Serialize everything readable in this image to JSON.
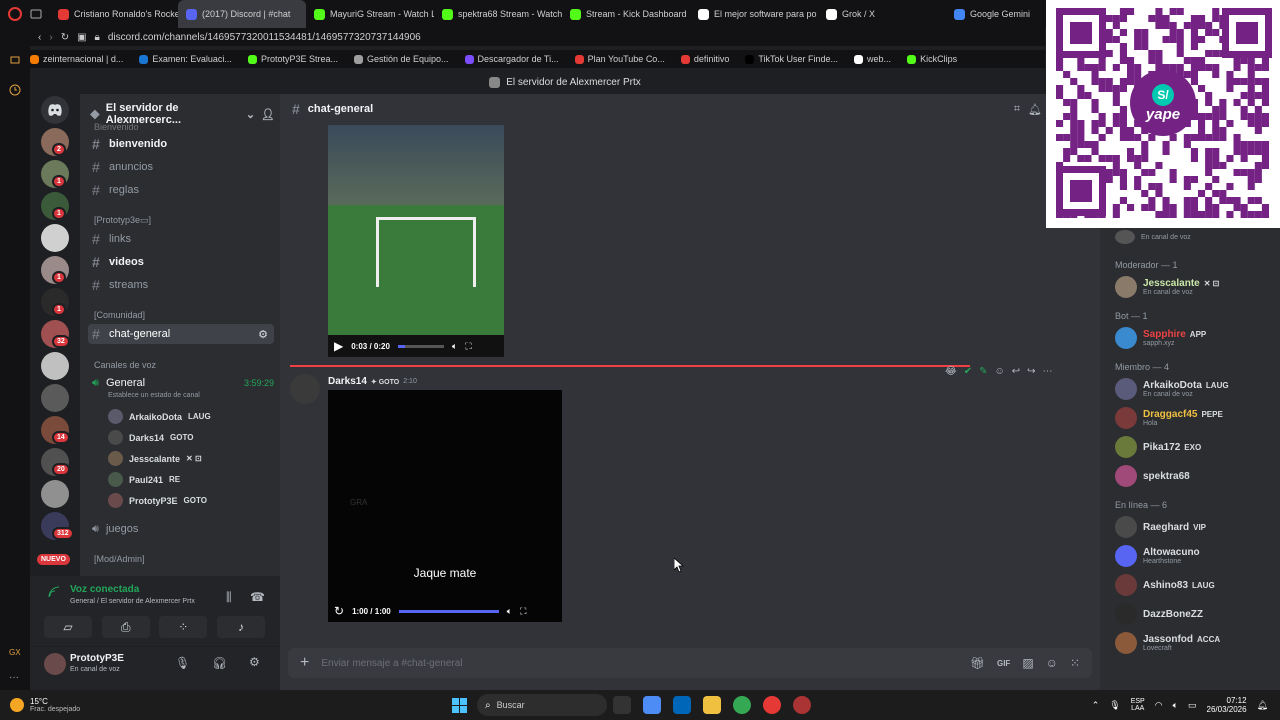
{
  "browser": {
    "tabs": [
      {
        "label": "Cristiano Ronaldo's Rocke",
        "color": "#e53935"
      },
      {
        "label": "(2017) Discord | #chat",
        "color": "#5865f2"
      },
      {
        "label": "MayuriG Stream - Watch L",
        "color": "#53fc18"
      },
      {
        "label": "spektra68 Stream - Watch",
        "color": "#53fc18"
      },
      {
        "label": "Stream - Kick Dashboard",
        "color": "#53fc18"
      },
      {
        "label": "El mejor software para po",
        "color": "#ffffff"
      },
      {
        "label": "Grok / X",
        "color": "#ffffff"
      },
      {
        "label": "Google Gemini",
        "color": "#4285f4"
      }
    ],
    "url": "discord.com/channels/1469577320011534481/1469577320737144906",
    "bookmarks": [
      {
        "label": "zeinternacional | d...",
        "color": "#f57c00"
      },
      {
        "label": "Examen: Evaluaci...",
        "color": "#1976d2"
      },
      {
        "label": "PrototyP3E Strea...",
        "color": "#53fc18"
      },
      {
        "label": "Gestión de Equipo...",
        "color": "#9e9e9e"
      },
      {
        "label": "Descargador de Ti...",
        "color": "#7c4dff"
      },
      {
        "label": "Plan YouTube Co...",
        "color": "#e53935"
      },
      {
        "label": "definitivo",
        "color": "#e53935"
      },
      {
        "label": "TikTok User Finde...",
        "color": "#000000"
      },
      {
        "label": "web...",
        "color": "#ffffff"
      },
      {
        "label": "KickClips",
        "color": "#53fc18"
      }
    ]
  },
  "app": {
    "window_title": "El servidor de Alexmercer Prtx",
    "server_name": "El servidor de Alexmercerc...",
    "new_badge": "NUEVO"
  },
  "servers": [
    {
      "badge": "2",
      "color": "#8a6a5a"
    },
    {
      "badge": "1",
      "color": "#6a7a5a"
    },
    {
      "badge": "1",
      "color": "#3a5a3a"
    },
    {
      "badge": "",
      "color": "#d0d0d0"
    },
    {
      "badge": "1",
      "color": "#9a8a8a"
    },
    {
      "badge": "1",
      "color": "#2a2a2a"
    },
    {
      "badge": "32",
      "color": "#a05050"
    },
    {
      "badge": "",
      "color": "#c0c0c0"
    },
    {
      "badge": "",
      "color": "#5a5a5a"
    },
    {
      "badge": "14",
      "color": "#7a4a3a"
    },
    {
      "badge": "20",
      "color": "#505050"
    },
    {
      "badge": "",
      "color": "#909090"
    },
    {
      "badge": "312",
      "color": "#3a3a5a"
    }
  ],
  "channels": {
    "top_partial": "Bienvenido",
    "items1": [
      "bienvenido",
      "anuncios",
      "reglas"
    ],
    "cat_prototype": "Prototyp3e",
    "items2": [
      "links",
      "videos",
      "streams"
    ],
    "cat_comunidad": "Comunidad",
    "selected": "chat-general",
    "voice_category": "Canales de voz",
    "voice_channel": "General",
    "voice_time": "3:59:29",
    "voice_status": "Establece un estado de canal",
    "voice_users": [
      {
        "name": "ArkaikoDota",
        "tag": "LAUG",
        "color": "#5a5a6a"
      },
      {
        "name": "Darks14",
        "tag": "GOTO",
        "color": "#4a4a4a"
      },
      {
        "name": "Jesscalante",
        "tag": "✕ ⊡",
        "color": "#6a5a4a"
      },
      {
        "name": "Paul241",
        "tag": "RE",
        "color": "#4a5a4a"
      },
      {
        "name": "PrototyP3E",
        "tag": "GOTO",
        "color": "#6a4a4a"
      }
    ],
    "juegos": "juegos",
    "cat_mod": "Mod/Admin"
  },
  "voice_panel": {
    "title": "Voz conectada",
    "subtitle": "General / El servidor de Alexmercer Prtx"
  },
  "user_panel": {
    "name": "PrototyP3E",
    "status": "En canal de voz"
  },
  "chat": {
    "channel": "chat-general",
    "video1": {
      "time": "0:03 / 0:20",
      "progress": 0.15
    },
    "message": {
      "author": "Darks14",
      "tag": "GOTO",
      "time": "2:10"
    },
    "video2": {
      "caption": "Jaque mate",
      "watermark": "GRA",
      "time": "1:00 / 1:00",
      "progress": 1.0
    },
    "input_placeholder": "Enviar mensaje a #chat-general"
  },
  "members": {
    "top_status": "En canal de voz",
    "groups": [
      {
        "title": "Moderador — 1",
        "items": [
          {
            "name": "Jesscalante",
            "tag": "✕ ⊡",
            "sub": "En canal de voz",
            "color": "#c9e8a8",
            "avatar": "#8a7a6a"
          }
        ]
      },
      {
        "title": "Bot — 1",
        "items": [
          {
            "name": "Sapphire",
            "tag": "APP",
            "sub": "sapph.xyz",
            "color": "#ed4245",
            "avatar": "#3a8ad0"
          }
        ]
      },
      {
        "title": "Miembro — 4",
        "items": [
          {
            "name": "ArkaikoDota",
            "tag": "LAUG",
            "sub": "En canal de voz",
            "color": "#dbdee1",
            "avatar": "#5a5a7a"
          },
          {
            "name": "Draggacf45",
            "tag": "PEPE",
            "sub": "Hola",
            "color": "#f0c040",
            "avatar": "#7a3a3a"
          },
          {
            "name": "Pika172",
            "tag": "EXO",
            "sub": "",
            "color": "#dbdee1",
            "avatar": "#6a7a3a"
          },
          {
            "name": "spektra68",
            "tag": "",
            "sub": "",
            "color": "#dbdee1",
            "avatar": "#a04a7a"
          }
        ]
      },
      {
        "title": "En línea — 6",
        "items": [
          {
            "name": "Raeghard",
            "tag": "VIP",
            "sub": "",
            "color": "#dbdee1",
            "avatar": "#4a4a4a"
          },
          {
            "name": "Altowacuno",
            "tag": "",
            "sub": "Hearthstone",
            "color": "#dbdee1",
            "avatar": "#5865f2"
          },
          {
            "name": "Ashino83",
            "tag": "LAUG",
            "sub": "",
            "color": "#dbdee1",
            "avatar": "#6a3a3a"
          },
          {
            "name": "DazzBoneZZ",
            "tag": "",
            "sub": "",
            "color": "#dbdee1",
            "avatar": "#2a2a2a"
          },
          {
            "name": "Jassonfod",
            "tag": "ACCA",
            "sub": "Lovecraft",
            "color": "#dbdee1",
            "avatar": "#8a5a3a"
          }
        ]
      }
    ]
  },
  "qr": {
    "brand": "yape",
    "mark": "S/",
    "color": "#742384"
  },
  "taskbar": {
    "weather_temp": "15°C",
    "weather_desc": "Frac. despejado",
    "search": "Buscar",
    "lang": "ESP",
    "lang2": "LAA",
    "time": "07:12",
    "date": "26/03/2026"
  }
}
